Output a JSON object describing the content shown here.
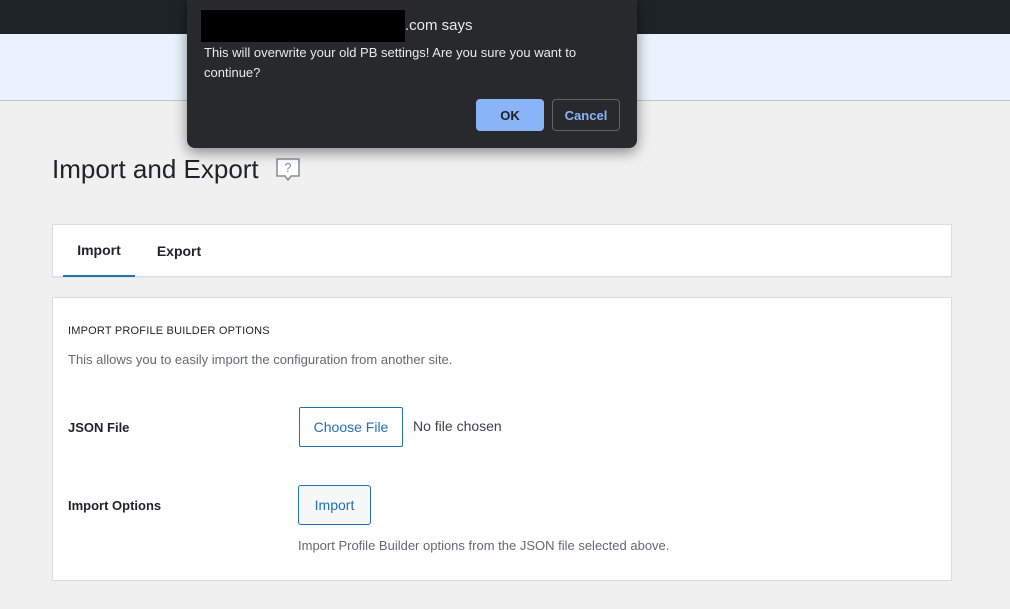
{
  "page": {
    "title": "Import and Export"
  },
  "tabs": [
    {
      "label": "Import",
      "active": true
    },
    {
      "label": "Export",
      "active": false
    }
  ],
  "section": {
    "title": "IMPORT PROFILE BUILDER OPTIONS",
    "description": "This allows you to easily import the configuration from another site."
  },
  "json_file": {
    "label": "JSON File",
    "button_label": "Choose File",
    "status": "No file chosen"
  },
  "import_options": {
    "label": "Import Options",
    "button_label": "Import",
    "help": "Import Profile Builder options from the JSON file selected above."
  },
  "dialog": {
    "origin_suffix": ".com says",
    "message": "This will overwrite your old PB settings! Are you sure you want to continue?",
    "ok_label": "OK",
    "cancel_label": "Cancel"
  },
  "colors": {
    "accent": "#2271b1",
    "dialog_bg": "#28292c",
    "dialog_button": "#8ab4f8"
  }
}
